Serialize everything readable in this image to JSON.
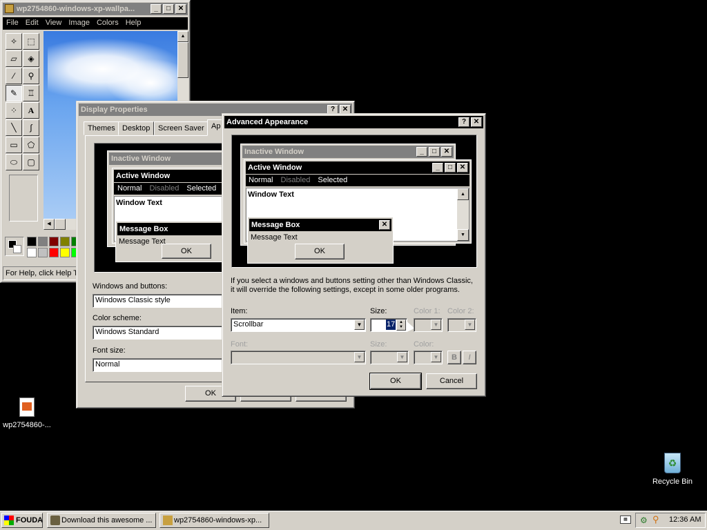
{
  "paint": {
    "title": "wp2754860-windows-xp-wallpa...",
    "menu": [
      "File",
      "Edit",
      "View",
      "Image",
      "Colors",
      "Help"
    ],
    "status": "For Help, click Help To"
  },
  "display_props": {
    "title": "Display Properties",
    "tabs": [
      "Themes",
      "Desktop",
      "Screen Saver",
      "Ap"
    ],
    "preview": {
      "inactive_title": "Inactive Window",
      "active_title": "Active Window",
      "menu_normal": "Normal",
      "menu_disabled": "Disabled",
      "menu_selected": "Selected",
      "window_text": "Window Text",
      "msgbox_title": "Message Box",
      "msgbox_text": "Message Text",
      "ok": "OK"
    },
    "windows_buttons_label": "Windows and buttons:",
    "windows_buttons_value": "Windows Classic style",
    "color_scheme_label": "Color scheme:",
    "color_scheme_value": "Windows Standard",
    "font_size_label": "Font size:",
    "font_size_value": "Normal",
    "ok": "OK"
  },
  "advanced": {
    "title": "Advanced Appearance",
    "preview": {
      "inactive_title": "Inactive Window",
      "active_title": "Active Window",
      "menu_normal": "Normal",
      "menu_disabled": "Disabled",
      "menu_selected": "Selected",
      "window_text": "Window Text",
      "msgbox_title": "Message Box",
      "msgbox_text": "Message Text",
      "ok": "OK"
    },
    "info_line1": "If you select a windows and buttons setting other than Windows Classic,",
    "info_line2": "it will override the following settings, except in some older programs.",
    "item_label": "Item:",
    "item_value": "Scrollbar",
    "size_label": "Size:",
    "size_value": "17",
    "color1_label": "Color 1:",
    "color2_label": "Color 2:",
    "font_label": "Font:",
    "font_size_label": "Size:",
    "font_color_label": "Color:",
    "bold": "B",
    "italic": "I",
    "ok": "OK",
    "cancel": "Cancel"
  },
  "desktop": {
    "file_icon_label": "wp2754860-...",
    "recycle_label": "Recycle Bin"
  },
  "taskbar": {
    "start": "FOUDA",
    "task1": "Download this awesome ...",
    "task2": "wp2754860-windows-xp...",
    "clock": "12:36 AM"
  }
}
